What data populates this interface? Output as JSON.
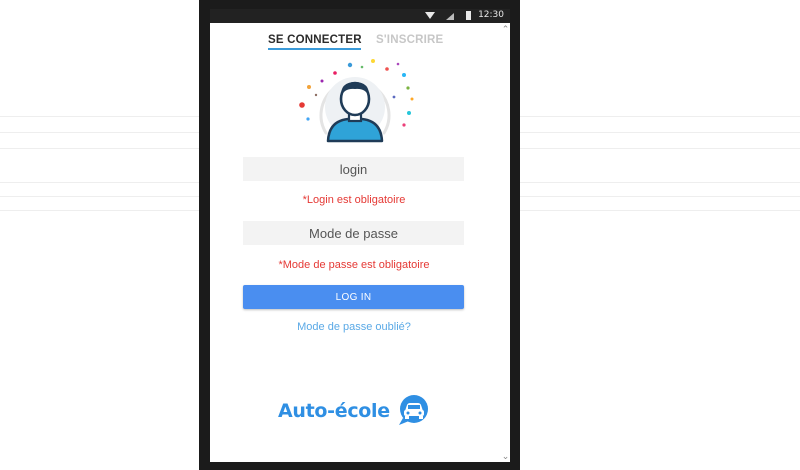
{
  "status_bar": {
    "time": "12:30"
  },
  "tabs": {
    "login": "SE CONNECTER",
    "register": "S'INSCRIRE"
  },
  "form": {
    "login_placeholder": "login",
    "login_error": "*Login est obligatoire",
    "password_placeholder": "Mode de passe",
    "password_error": "*Mode de passe est obligatoire",
    "submit_label": "LOG IN",
    "forgot_label": "Mode de passe oublié?"
  },
  "brand": {
    "name": "Auto-école"
  },
  "colors": {
    "accent": "#4a8ef0",
    "error": "#e53935",
    "link": "#5aa9e6",
    "tab_underline": "#3a9ad9"
  },
  "icons": [
    "wifi-icon",
    "signal-icon",
    "battery-icon",
    "user-avatar-icon",
    "car-chat-icon"
  ]
}
